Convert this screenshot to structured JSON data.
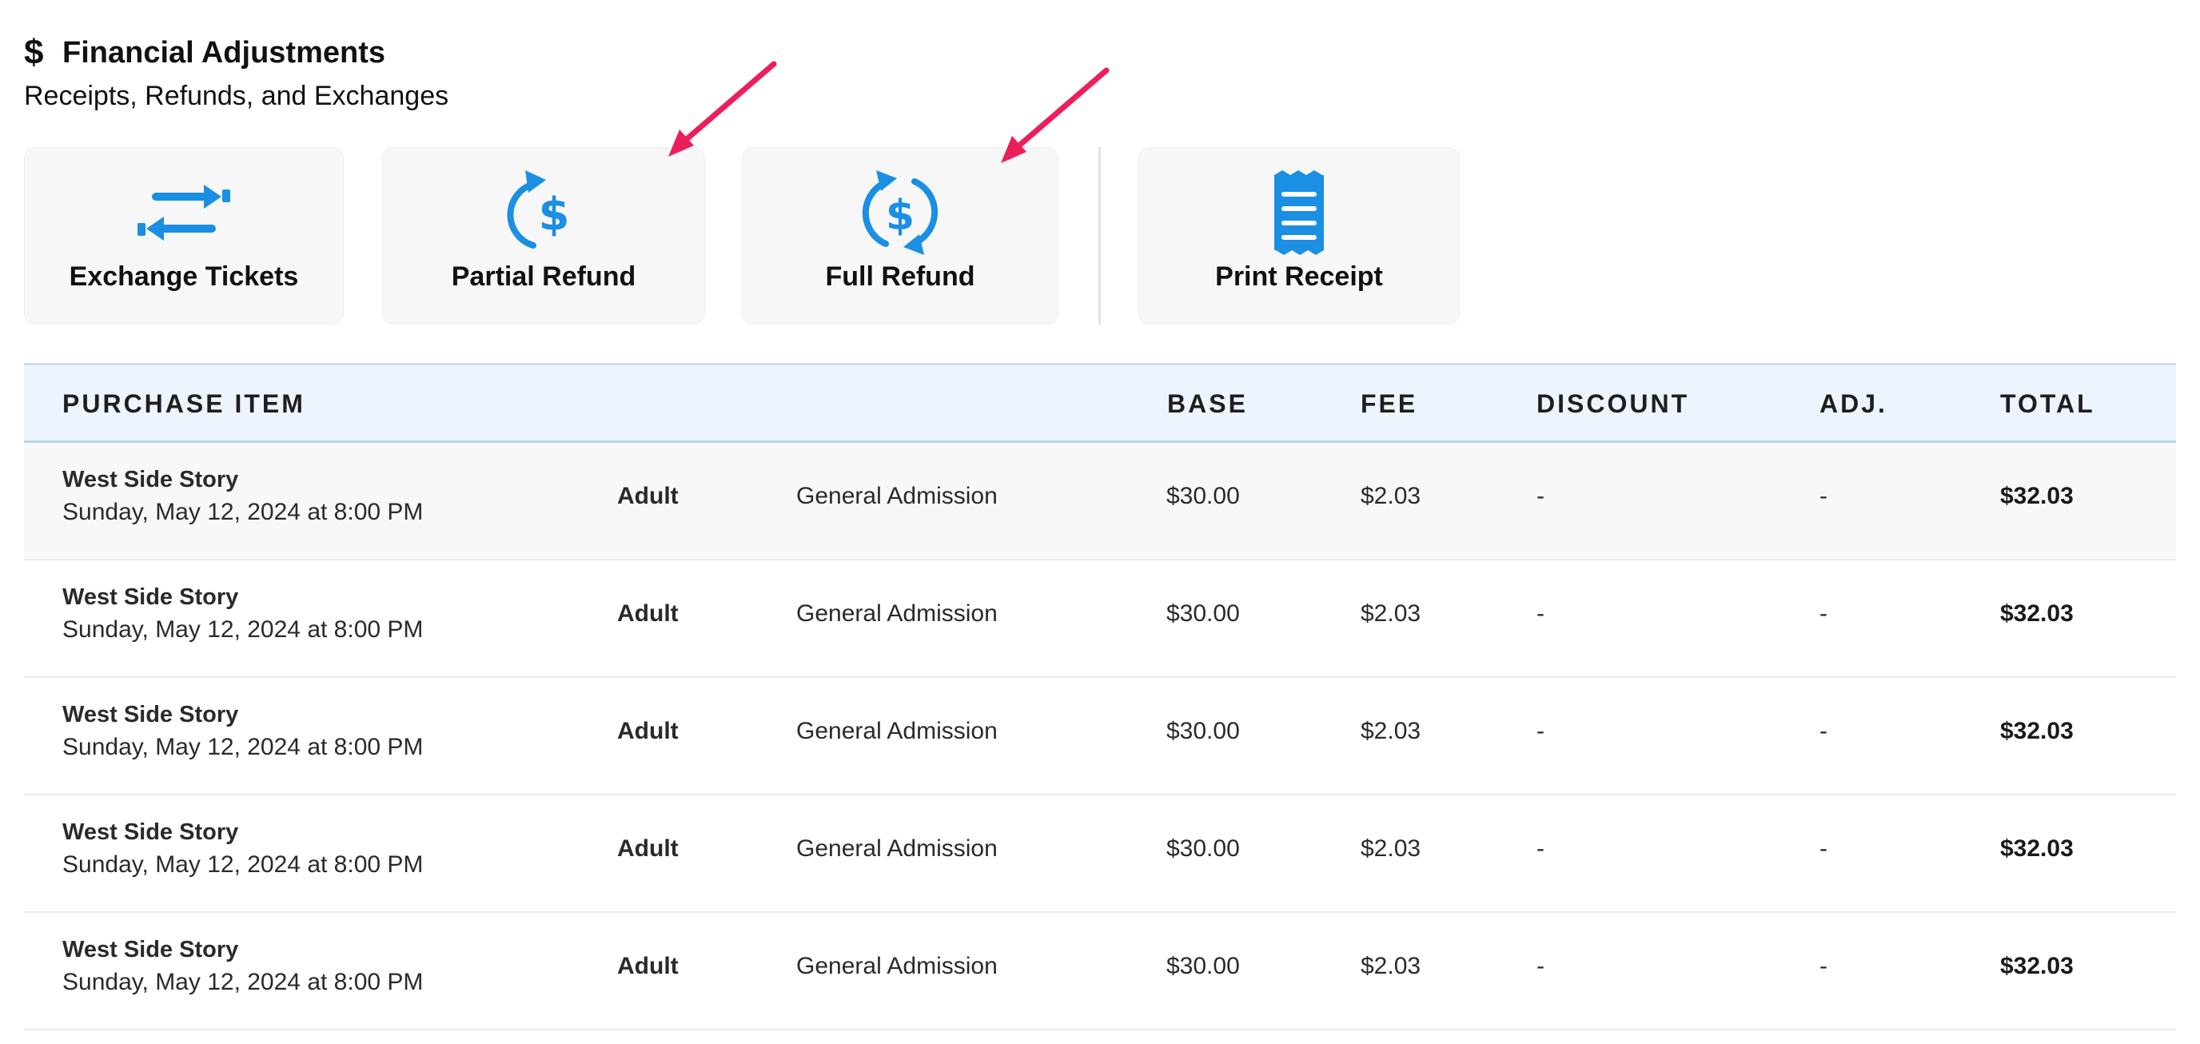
{
  "header": {
    "icon": "dollar-icon",
    "icon_glyph": "$",
    "title": "Financial Adjustments",
    "subtitle": "Receipts, Refunds, and Exchanges"
  },
  "actions": [
    {
      "label": "Exchange Tickets",
      "icon": "exchange-arrows-icon"
    },
    {
      "label": "Partial Refund",
      "icon": "partial-refund-icon"
    },
    {
      "label": "Full Refund",
      "icon": "full-refund-icon"
    },
    {
      "label": "Print Receipt",
      "icon": "receipt-icon"
    }
  ],
  "colors": {
    "icon_blue": "#1a8fe3",
    "annotation_arrow": "#ee1e5a",
    "header_bg": "#edf4fd"
  },
  "table": {
    "columns": [
      "PURCHASE ITEM",
      "BASE",
      "FEE",
      "DISCOUNT",
      "ADJ.",
      "TOTAL"
    ],
    "rows": [
      {
        "event": "West Side Story",
        "date": "Sunday, May 12, 2024 at 8:00 PM",
        "ticket_type": "Adult",
        "section": "General Admission",
        "base": "$30.00",
        "fee": "$2.03",
        "discount": "-",
        "adj": "-",
        "total": "$32.03"
      },
      {
        "event": "West Side Story",
        "date": "Sunday, May 12, 2024 at 8:00 PM",
        "ticket_type": "Adult",
        "section": "General Admission",
        "base": "$30.00",
        "fee": "$2.03",
        "discount": "-",
        "adj": "-",
        "total": "$32.03"
      },
      {
        "event": "West Side Story",
        "date": "Sunday, May 12, 2024 at 8:00 PM",
        "ticket_type": "Adult",
        "section": "General Admission",
        "base": "$30.00",
        "fee": "$2.03",
        "discount": "-",
        "adj": "-",
        "total": "$32.03"
      },
      {
        "event": "West Side Story",
        "date": "Sunday, May 12, 2024 at 8:00 PM",
        "ticket_type": "Adult",
        "section": "General Admission",
        "base": "$30.00",
        "fee": "$2.03",
        "discount": "-",
        "adj": "-",
        "total": "$32.03"
      },
      {
        "event": "West Side Story",
        "date": "Sunday, May 12, 2024 at 8:00 PM",
        "ticket_type": "Adult",
        "section": "General Admission",
        "base": "$30.00",
        "fee": "$2.03",
        "discount": "-",
        "adj": "-",
        "total": "$32.03"
      }
    ]
  }
}
